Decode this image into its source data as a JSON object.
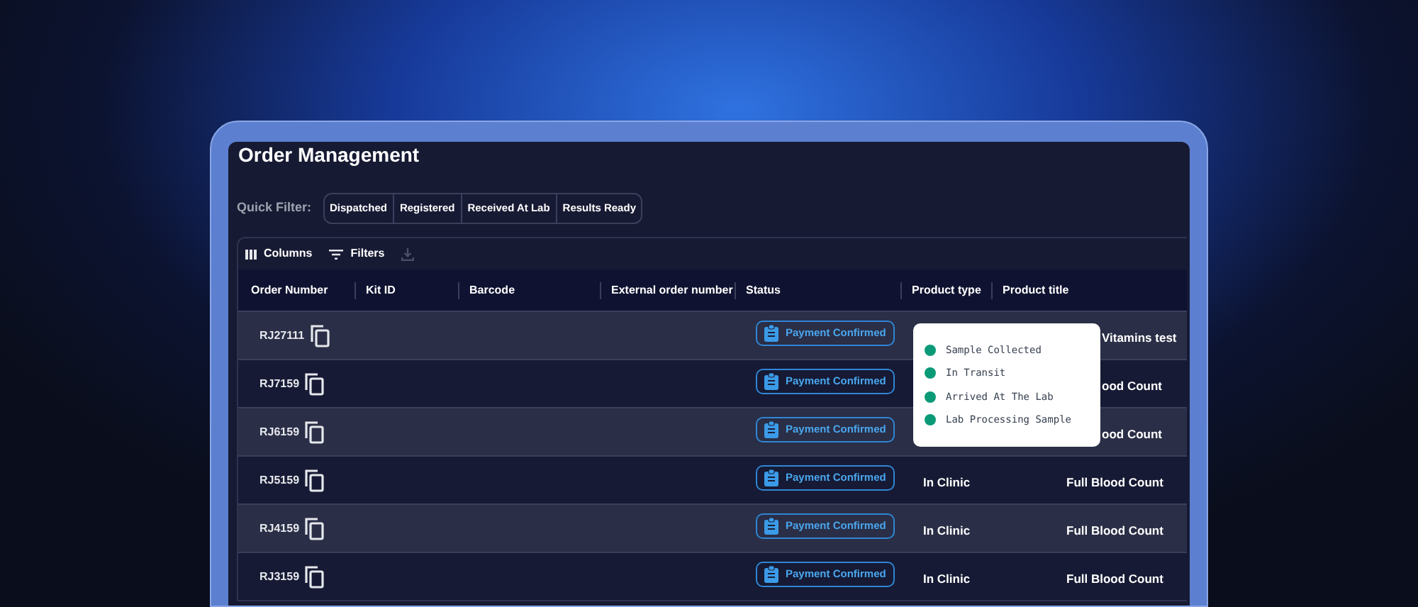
{
  "page": {
    "title": "Order Management"
  },
  "quick_filter": {
    "label": "Quick Filter:",
    "options": [
      "Dispatched",
      "Registered",
      "Received At Lab",
      "Results Ready"
    ]
  },
  "toolbar": {
    "columns": "Columns",
    "filters": "Filters",
    "export_disabled": true
  },
  "table": {
    "columns": [
      "Order Number",
      "Kit ID",
      "Barcode",
      "External order number",
      "Status",
      "Product type",
      "Product title"
    ],
    "rows": [
      {
        "order_number": "RJ27111",
        "status": "Payment Confirmed",
        "product_type": null,
        "product_title": "Vitamins test",
        "covered": true
      },
      {
        "order_number": "RJ7159",
        "status": "Payment Confirmed",
        "product_type": null,
        "product_title": "ood Count",
        "covered": true
      },
      {
        "order_number": "RJ6159",
        "status": "Payment Confirmed",
        "product_type": null,
        "product_title": "ood Count",
        "covered": true
      },
      {
        "order_number": "RJ5159",
        "status": "Payment Confirmed",
        "product_type": "In Clinic",
        "product_title": "Full Blood Count",
        "covered": false
      },
      {
        "order_number": "RJ4159",
        "status": "Payment Confirmed",
        "product_type": "In Clinic",
        "product_title": "Full Blood Count",
        "covered": false
      },
      {
        "order_number": "RJ3159",
        "status": "Payment Confirmed",
        "product_type": "In Clinic",
        "product_title": "Full Blood Count",
        "covered": false
      }
    ]
  },
  "status_popup": {
    "steps": [
      "Sample Collected",
      "In Transit",
      "Arrived At The Lab",
      "Lab Processing Sample"
    ]
  }
}
